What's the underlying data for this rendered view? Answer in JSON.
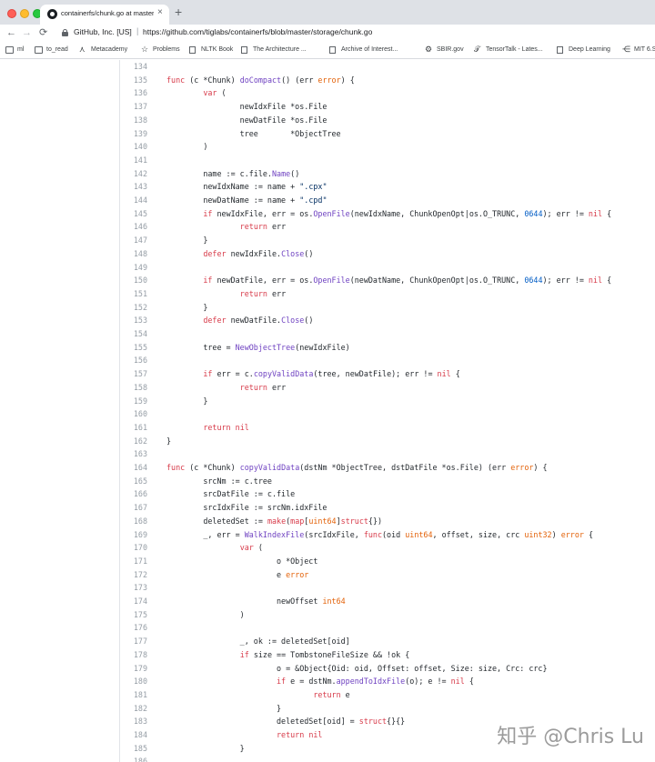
{
  "browser": {
    "tab": {
      "title": "containerfs/chunk.go at master",
      "close_glyph": "×"
    },
    "new_tab_glyph": "+",
    "nav": {
      "back_glyph": "←",
      "forward_glyph": "→",
      "reload_glyph": "⟳"
    },
    "site_identity": "GitHub, Inc. [US]",
    "url_separator": "|",
    "url": "https://github.com/tiglabs/containerfs/blob/master/storage/chunk.go"
  },
  "bookmarks": [
    {
      "label": "ml",
      "icon": "folder-icon"
    },
    {
      "label": "to_read",
      "icon": "folder-icon"
    },
    {
      "label": "Metacademy",
      "icon": "metacademy-icon"
    },
    {
      "label": "Problems",
      "icon": "star-icon"
    },
    {
      "label": "NLTK Book",
      "icon": "document-icon"
    },
    {
      "label": "The Architecture ...",
      "icon": "document-icon"
    },
    {
      "label": "Archive of Interest...",
      "icon": "document-icon"
    },
    {
      "label": "SBIR.gov",
      "icon": "gear-icon"
    },
    {
      "label": "TensorTalk - Lates...",
      "icon": "tensortalk-icon"
    },
    {
      "label": "Deep Learning",
      "icon": "document-icon"
    },
    {
      "label": "MIT 6.S",
      "icon": "share-icon"
    }
  ],
  "code": {
    "lines": [
      {
        "n": "134",
        "t": ""
      },
      {
        "n": "135",
        "t": "func (c *Chunk) doCompact() (err error) {"
      },
      {
        "n": "136",
        "t": "        var ("
      },
      {
        "n": "137",
        "t": "                newIdxFile *os.File"
      },
      {
        "n": "138",
        "t": "                newDatFile *os.File"
      },
      {
        "n": "139",
        "t": "                tree       *ObjectTree"
      },
      {
        "n": "140",
        "t": "        )"
      },
      {
        "n": "141",
        "t": ""
      },
      {
        "n": "142",
        "t": "        name := c.file.Name()"
      },
      {
        "n": "143",
        "t": "        newIdxName := name + \".cpx\""
      },
      {
        "n": "144",
        "t": "        newDatName := name + \".cpd\""
      },
      {
        "n": "145",
        "t": "        if newIdxFile, err = os.OpenFile(newIdxName, ChunkOpenOpt|os.O_TRUNC, 0644); err != nil {"
      },
      {
        "n": "146",
        "t": "                return err"
      },
      {
        "n": "147",
        "t": "        }"
      },
      {
        "n": "148",
        "t": "        defer newIdxFile.Close()"
      },
      {
        "n": "149",
        "t": ""
      },
      {
        "n": "150",
        "t": "        if newDatFile, err = os.OpenFile(newDatName, ChunkOpenOpt|os.O_TRUNC, 0644); err != nil {"
      },
      {
        "n": "151",
        "t": "                return err"
      },
      {
        "n": "152",
        "t": "        }"
      },
      {
        "n": "153",
        "t": "        defer newDatFile.Close()"
      },
      {
        "n": "154",
        "t": ""
      },
      {
        "n": "155",
        "t": "        tree = NewObjectTree(newIdxFile)"
      },
      {
        "n": "156",
        "t": ""
      },
      {
        "n": "157",
        "t": "        if err = c.copyValidData(tree, newDatFile); err != nil {"
      },
      {
        "n": "158",
        "t": "                return err"
      },
      {
        "n": "159",
        "t": "        }"
      },
      {
        "n": "160",
        "t": ""
      },
      {
        "n": "161",
        "t": "        return nil"
      },
      {
        "n": "162",
        "t": "}"
      },
      {
        "n": "163",
        "t": ""
      },
      {
        "n": "164",
        "t": "func (c *Chunk) copyValidData(dstNm *ObjectTree, dstDatFile *os.File) (err error) {"
      },
      {
        "n": "165",
        "t": "        srcNm := c.tree"
      },
      {
        "n": "166",
        "t": "        srcDatFile := c.file"
      },
      {
        "n": "167",
        "t": "        srcIdxFile := srcNm.idxFile"
      },
      {
        "n": "168",
        "t": "        deletedSet := make(map[uint64]struct{})"
      },
      {
        "n": "169",
        "t": "        _, err = WalkIndexFile(srcIdxFile, func(oid uint64, offset, size, crc uint32) error {"
      },
      {
        "n": "170",
        "t": "                var ("
      },
      {
        "n": "171",
        "t": "                        o *Object"
      },
      {
        "n": "172",
        "t": "                        e error"
      },
      {
        "n": "173",
        "t": ""
      },
      {
        "n": "174",
        "t": "                        newOffset int64"
      },
      {
        "n": "175",
        "t": "                )"
      },
      {
        "n": "176",
        "t": ""
      },
      {
        "n": "177",
        "t": "                _, ok := deletedSet[oid]"
      },
      {
        "n": "178",
        "t": "                if size == TombstoneFileSize && !ok {"
      },
      {
        "n": "179",
        "t": "                        o = &Object{Oid: oid, Offset: offset, Size: size, Crc: crc}"
      },
      {
        "n": "180",
        "t": "                        if e = dstNm.appendToIdxFile(o); e != nil {"
      },
      {
        "n": "181",
        "t": "                                return e"
      },
      {
        "n": "182",
        "t": "                        }"
      },
      {
        "n": "183",
        "t": "                        deletedSet[oid] = struct{}{}"
      },
      {
        "n": "184",
        "t": "                        return nil"
      },
      {
        "n": "185",
        "t": "                }"
      },
      {
        "n": "186",
        "t": ""
      }
    ]
  },
  "watermark": "知乎 @Chris Lu",
  "colors": {
    "keyword": "#d73a49",
    "function": "#6f42c1",
    "string": "#032f62",
    "number": "#005cc5",
    "type": "#e36209",
    "line_number": "#959da5"
  }
}
